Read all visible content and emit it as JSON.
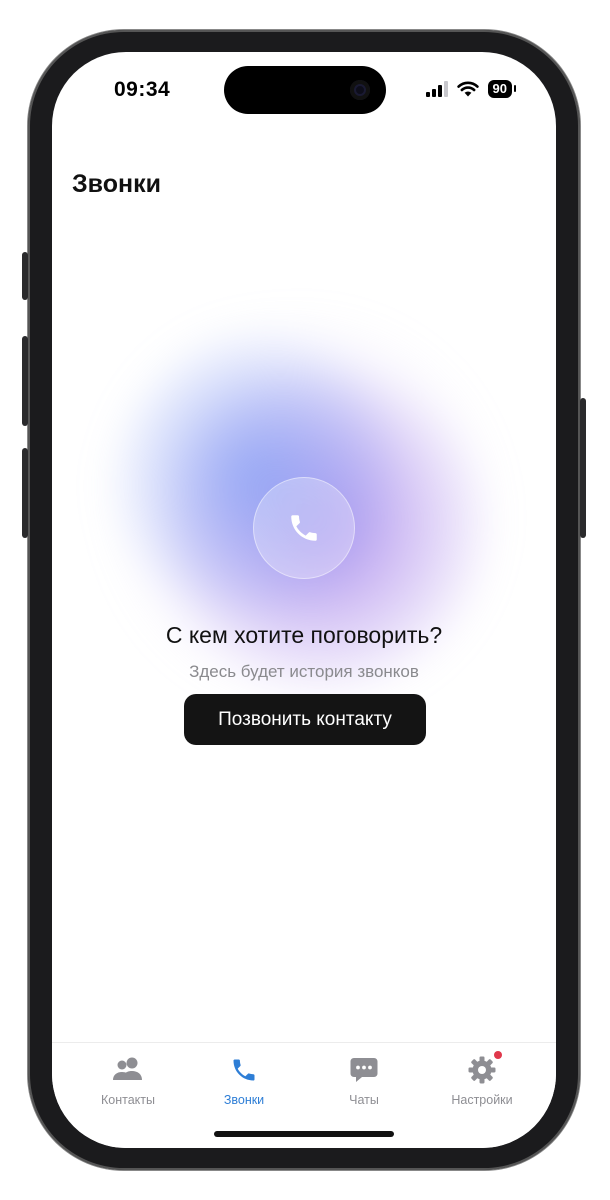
{
  "status_bar": {
    "time": "09:34",
    "battery": "90",
    "icons": [
      "signal-icon",
      "wifi-icon",
      "battery-icon"
    ]
  },
  "header": {
    "title": "Звонки"
  },
  "empty_state": {
    "icon": "phone-icon",
    "title": "С кем хотите поговорить?",
    "subtitle": "Здесь будет история звонков",
    "button_label": "Позвонить контакту"
  },
  "tabbar": {
    "tabs": [
      {
        "label": "Контакты",
        "icon": "contacts-icon",
        "active": false
      },
      {
        "label": "Звонки",
        "icon": "phone-icon",
        "active": true
      },
      {
        "label": "Чаты",
        "icon": "chat-icon",
        "active": false
      },
      {
        "label": "Настройки",
        "icon": "gear-icon",
        "active": false,
        "badge": true
      }
    ]
  },
  "colors": {
    "accent": "#2e7ed6",
    "button_bg": "#141414",
    "badge": "#e0384b",
    "inactive": "#8e8e93"
  }
}
